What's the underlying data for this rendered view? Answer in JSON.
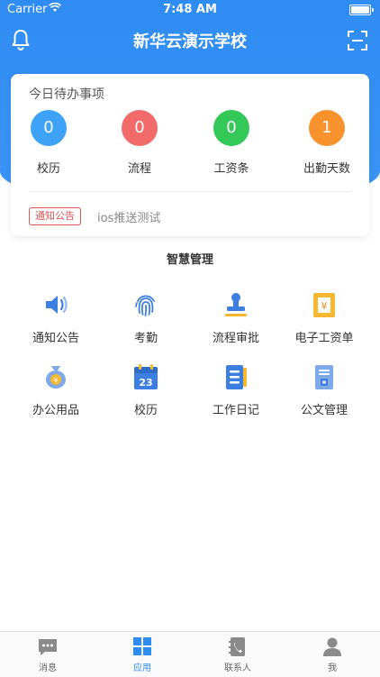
{
  "status_bar": {
    "carrier": "Carrier",
    "time": "7:48 AM"
  },
  "header": {
    "title": "新华云演示学校"
  },
  "todo": {
    "title": "今日待办事项",
    "items": [
      {
        "label": "校历",
        "count": "0",
        "color": "#3ea3f7"
      },
      {
        "label": "流程",
        "count": "0",
        "color": "#f26a6a"
      },
      {
        "label": "工资条",
        "count": "0",
        "color": "#34c858"
      },
      {
        "label": "出勤天数",
        "count": "1",
        "color": "#f7922d"
      }
    ],
    "notice_tag": "通知公告",
    "notice_text": "ios推送测试"
  },
  "section": {
    "title": "智慧管理"
  },
  "apps": [
    {
      "label": "通知公告",
      "icon": "speaker-icon"
    },
    {
      "label": "考勤",
      "icon": "fingerprint-icon"
    },
    {
      "label": "流程审批",
      "icon": "stamp-icon"
    },
    {
      "label": "电子工资单",
      "icon": "payslip-icon"
    },
    {
      "label": "办公用品",
      "icon": "money-bag-icon"
    },
    {
      "label": "校历",
      "icon": "calendar-icon"
    },
    {
      "label": "工作日记",
      "icon": "notebook-icon"
    },
    {
      "label": "公文管理",
      "icon": "document-icon"
    }
  ],
  "calendar_day": "23",
  "currency_symbol": "¥",
  "tabs": [
    {
      "label": "消息",
      "icon": "message-icon",
      "active": false
    },
    {
      "label": "应用",
      "icon": "apps-grid-icon",
      "active": true
    },
    {
      "label": "联系人",
      "icon": "contacts-icon",
      "active": false
    },
    {
      "label": "我",
      "icon": "profile-icon",
      "active": false
    }
  ],
  "colors": {
    "primary": "#2f8cf3",
    "icon_blue": "#3d7fe0",
    "icon_gold": "#f5b830"
  }
}
